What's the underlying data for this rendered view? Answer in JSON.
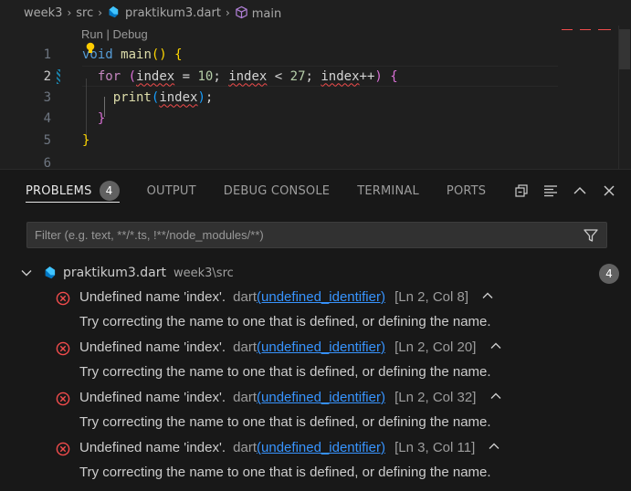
{
  "breadcrumb": {
    "folder1": "week3",
    "folder2": "src",
    "file": "praktikum3.dart",
    "symbol": "main"
  },
  "editor": {
    "codelens": "Run | Debug",
    "line_numbers": [
      "1",
      "2",
      "3",
      "4",
      "5",
      "6"
    ],
    "active_line": "2"
  },
  "panel": {
    "tabs": [
      {
        "label": "PROBLEMS",
        "badge": "4"
      },
      {
        "label": "OUTPUT"
      },
      {
        "label": "DEBUG CONSOLE"
      },
      {
        "label": "TERMINAL"
      },
      {
        "label": "PORTS"
      }
    ],
    "filter_placeholder": "Filter (e.g. text, **/*.ts, !**/node_modules/**)",
    "file_group": {
      "name": "praktikum3.dart",
      "path": "week3\\src",
      "count": "4"
    },
    "problems": [
      {
        "message": "Undefined name 'index'.",
        "source": "dart",
        "code": "(undefined_identifier)",
        "location": "[Ln 2, Col 8]",
        "hint": "Try correcting the name to one that is defined, or defining the name."
      },
      {
        "message": "Undefined name 'index'.",
        "source": "dart",
        "code": "(undefined_identifier)",
        "location": "[Ln 2, Col 20]",
        "hint": "Try correcting the name to one that is defined, or defining the name."
      },
      {
        "message": "Undefined name 'index'.",
        "source": "dart",
        "code": "(undefined_identifier)",
        "location": "[Ln 2, Col 32]",
        "hint": "Try correcting the name to one that is defined, or defining the name."
      },
      {
        "message": "Undefined name 'index'.",
        "source": "dart",
        "code": "(undefined_identifier)",
        "location": "[Ln 3, Col 11]",
        "hint": "Try correcting the name to one that is defined, or defining the name."
      }
    ]
  },
  "colors": {
    "error": "#f14c4c",
    "link": "#3794ff",
    "dart_blue": "#40c4ff",
    "dart_navy": "#0175c2"
  }
}
